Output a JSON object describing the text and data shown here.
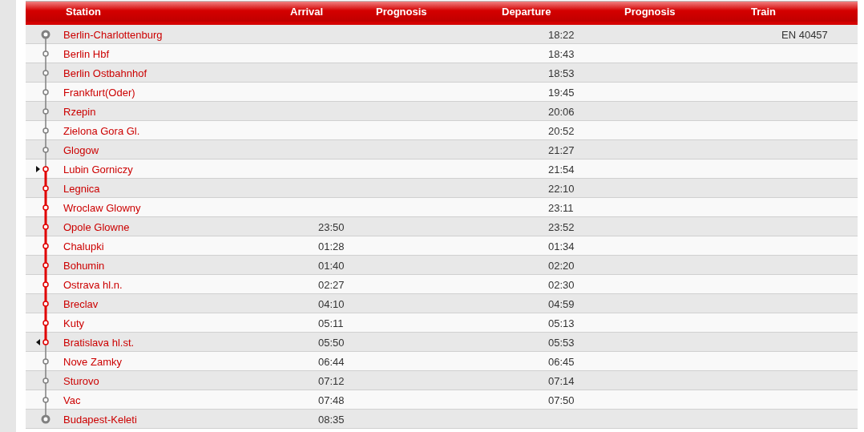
{
  "columns": [
    "Station",
    "Arrival",
    "Prognosis",
    "Departure",
    "Prognosis",
    "Train"
  ],
  "stops": [
    {
      "kind": "terminus",
      "name": "Berlin-Charlottenburg",
      "departure": "18:22",
      "train": "EN 40457",
      "highlighted": false,
      "journey_start": false,
      "journey_end": false
    },
    {
      "kind": "stop",
      "name": "Berlin Hbf",
      "departure": "18:43",
      "highlighted": false,
      "journey_start": false,
      "journey_end": false
    },
    {
      "kind": "stop",
      "name": "Berlin Ostbahnhof",
      "departure": "18:53",
      "highlighted": false,
      "journey_start": false,
      "journey_end": false
    },
    {
      "kind": "stop",
      "name": "Frankfurt(Oder)",
      "departure": "19:45",
      "highlighted": false,
      "journey_start": false,
      "journey_end": false
    },
    {
      "kind": "stop",
      "name": "Rzepin",
      "departure": "20:06",
      "highlighted": false,
      "journey_start": false,
      "journey_end": false
    },
    {
      "kind": "stop",
      "name": "Zielona Gora Gl.",
      "departure": "20:52",
      "highlighted": false,
      "journey_start": false,
      "journey_end": false
    },
    {
      "kind": "stop",
      "name": "Glogow",
      "departure": "21:27",
      "highlighted": false,
      "journey_start": false,
      "journey_end": false
    },
    {
      "kind": "stop",
      "name": "Lubin Gorniczy",
      "departure": "21:54",
      "highlighted": true,
      "journey_start": true,
      "journey_end": false
    },
    {
      "kind": "stop",
      "name": "Legnica",
      "departure": "22:10",
      "highlighted": true,
      "journey_start": false,
      "journey_end": false
    },
    {
      "kind": "stop",
      "name": "Wroclaw Glowny",
      "departure": "23:11",
      "highlighted": true,
      "journey_start": false,
      "journey_end": false
    },
    {
      "kind": "stop",
      "name": "Opole Glowne",
      "arrival": "23:50",
      "departure": "23:52",
      "highlighted": true,
      "journey_start": false,
      "journey_end": false
    },
    {
      "kind": "stop",
      "name": "Chalupki",
      "arrival": "01:28",
      "departure": "01:34",
      "highlighted": true,
      "journey_start": false,
      "journey_end": false
    },
    {
      "kind": "stop",
      "name": "Bohumin",
      "arrival": "01:40",
      "departure": "02:20",
      "highlighted": true,
      "journey_start": false,
      "journey_end": false
    },
    {
      "kind": "stop",
      "name": "Ostrava hl.n.",
      "arrival": "02:27",
      "departure": "02:30",
      "highlighted": true,
      "journey_start": false,
      "journey_end": false
    },
    {
      "kind": "stop",
      "name": "Breclav",
      "arrival": "04:10",
      "departure": "04:59",
      "highlighted": true,
      "journey_start": false,
      "journey_end": false
    },
    {
      "kind": "stop",
      "name": "Kuty",
      "arrival": "05:11",
      "departure": "05:13",
      "highlighted": true,
      "journey_start": false,
      "journey_end": false
    },
    {
      "kind": "stop",
      "name": "Bratislava hl.st.",
      "arrival": "05:50",
      "departure": "05:53",
      "highlighted": true,
      "journey_start": false,
      "journey_end": true
    },
    {
      "kind": "stop",
      "name": "Nove Zamky",
      "arrival": "06:44",
      "departure": "06:45",
      "highlighted": false,
      "journey_start": false,
      "journey_end": false
    },
    {
      "kind": "stop",
      "name": "Sturovo",
      "arrival": "07:12",
      "departure": "07:14",
      "highlighted": false,
      "journey_start": false,
      "journey_end": false
    },
    {
      "kind": "stop",
      "name": "Vac",
      "arrival": "07:48",
      "departure": "07:50",
      "highlighted": false,
      "journey_start": false,
      "journey_end": false
    },
    {
      "kind": "terminus",
      "name": "Budapest-Keleti",
      "arrival": "08:35",
      "highlighted": false,
      "journey_start": false,
      "journey_end": false
    }
  ]
}
